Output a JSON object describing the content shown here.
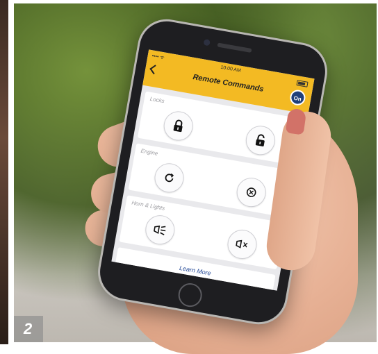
{
  "figure": {
    "number": "2"
  },
  "status_bar": {
    "carrier": "•••• ᯤ",
    "time": "10:00 AM"
  },
  "app": {
    "title": "Remote Commands",
    "status_badge": "On"
  },
  "sections": [
    {
      "title": "Locks",
      "left_icon": "lock-icon",
      "right_icon": "unlock-icon"
    },
    {
      "title": "Engine",
      "left_icon": "engine-start-icon",
      "right_icon": "engine-stop-icon"
    },
    {
      "title": "Horn & Lights",
      "left_icon": "horn-lights-icon",
      "right_icon": "horn-lights-off-icon"
    }
  ],
  "footer": {
    "learn_more_label": "Learn More"
  },
  "colors": {
    "header": "#f3ba23",
    "badge": "#1f3f7a",
    "link": "#2a4e9a"
  }
}
